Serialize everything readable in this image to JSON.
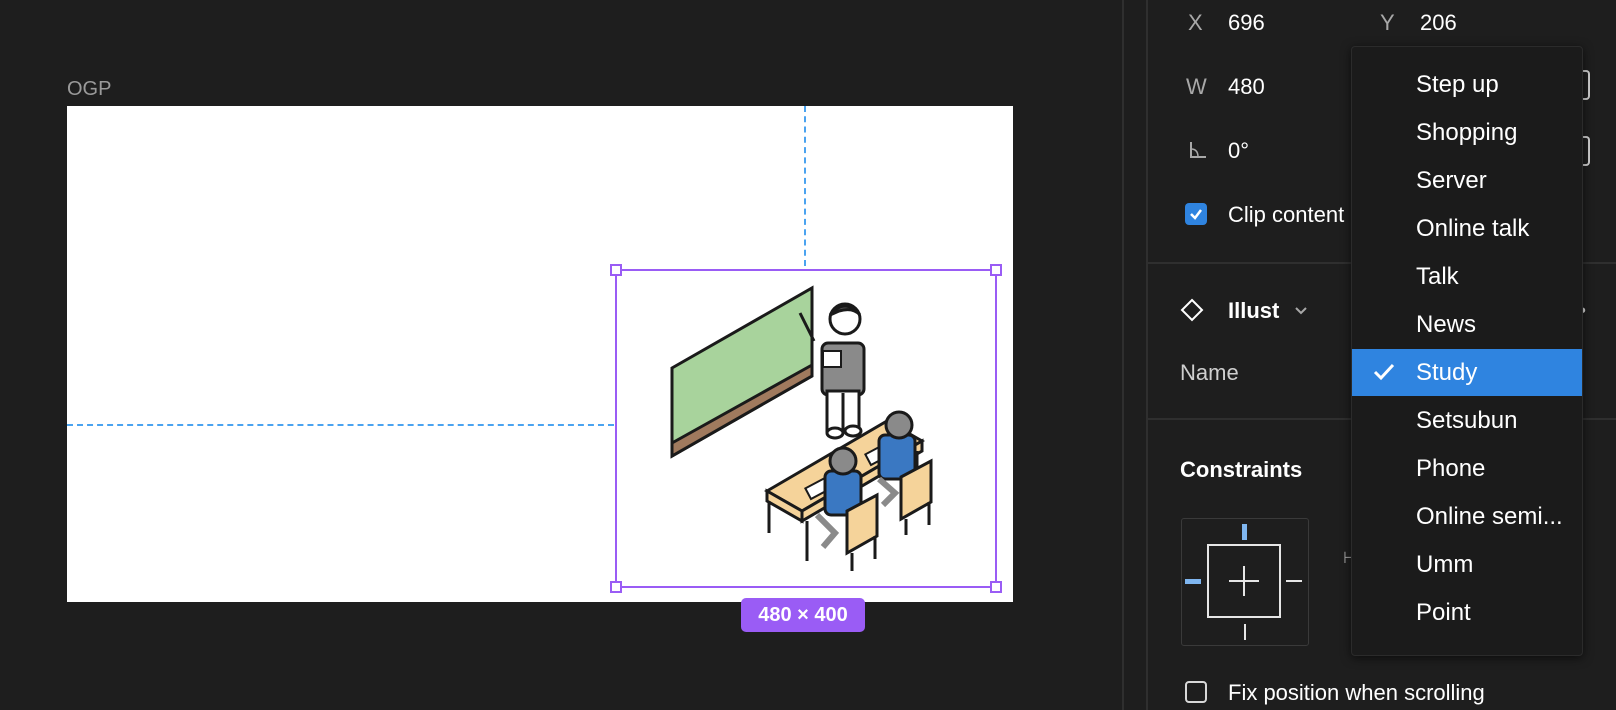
{
  "canvas": {
    "frame_label": "OGP",
    "size_badge": "480 × 400"
  },
  "panel": {
    "x_label": "X",
    "x_value": "696",
    "y_label": "Y",
    "y_value": "206",
    "w_label": "W",
    "w_value": "480",
    "rotation_value": "0°",
    "clip_content_label": "Clip content",
    "clip_content_checked": true,
    "component_name": "Illust",
    "name_label": "Name",
    "constraints_title": "Constraints",
    "fix_position_label": "Fix position when scrolling",
    "fix_position_checked": false
  },
  "menu": {
    "items": [
      {
        "label": "Step up"
      },
      {
        "label": "Shopping"
      },
      {
        "label": "Server"
      },
      {
        "label": "Online talk"
      },
      {
        "label": "Talk"
      },
      {
        "label": "News"
      },
      {
        "label": "Study",
        "selected": true
      },
      {
        "label": "Setsubun"
      },
      {
        "label": "Phone"
      },
      {
        "label": "Online semi..."
      },
      {
        "label": "Umm"
      },
      {
        "label": "Point"
      }
    ]
  },
  "colors": {
    "accent_selection": "#9a5cf5",
    "accent_blue": "#2f84e0",
    "guide_blue": "#4aa3f0",
    "blackboard_green": "#a8d39c",
    "desk_tan": "#f5d39a",
    "student_blue": "#3a78c2"
  }
}
